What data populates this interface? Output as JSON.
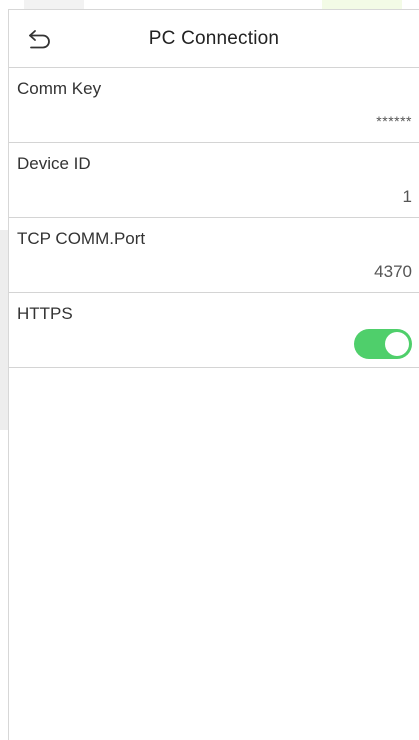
{
  "header": {
    "title": "PC Connection",
    "back_icon": "back-arrow-icon"
  },
  "settings": [
    {
      "label": "Comm Key",
      "value": "******"
    },
    {
      "label": "Device ID",
      "value": "1"
    },
    {
      "label": "TCP COMM.Port",
      "value": "4370"
    },
    {
      "label": "HTTPS",
      "toggle_on": true
    }
  ],
  "colors": {
    "toggle_on": "#4fcf6b",
    "divider": "#d4d4d4"
  }
}
